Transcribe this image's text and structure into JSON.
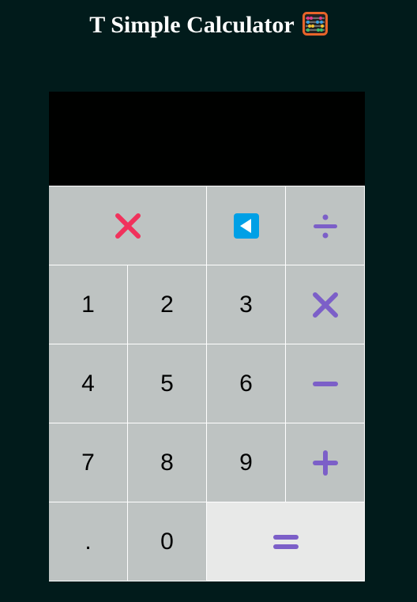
{
  "app": {
    "title": "T Simple Calculator"
  },
  "display": {
    "value": ""
  },
  "colors": {
    "operator": "#7c5fc8",
    "clear": "#f1325c",
    "backspace": "#00a0e6",
    "background": "#011b1b",
    "key": "#bec3c2",
    "equals_key": "#e8e9e8"
  },
  "keys": {
    "clear": {
      "icon": "close-icon"
    },
    "backspace": {
      "icon": "backspace-icon"
    },
    "divide": {
      "icon": "divide-icon"
    },
    "multiply": {
      "icon": "multiply-icon"
    },
    "subtract": {
      "icon": "minus-icon"
    },
    "add": {
      "icon": "plus-icon"
    },
    "equals": {
      "icon": "equals-icon"
    },
    "d1": "1",
    "d2": "2",
    "d3": "3",
    "d4": "4",
    "d5": "5",
    "d6": "6",
    "d7": "7",
    "d8": "8",
    "d9": "9",
    "dot": ".",
    "d0": "0"
  }
}
